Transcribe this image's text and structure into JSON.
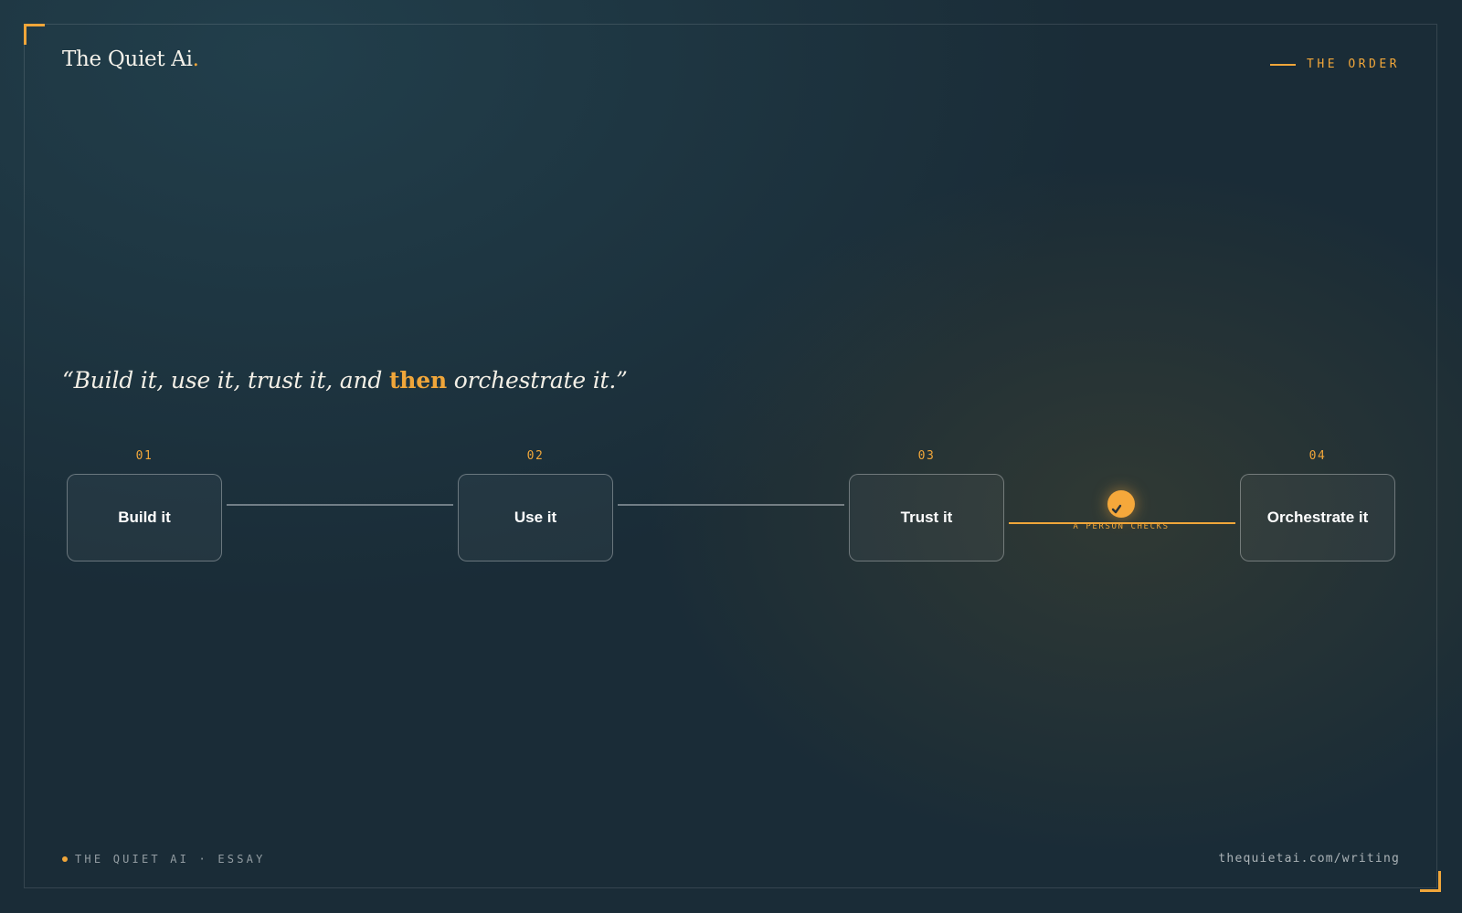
{
  "brand": {
    "name": "The Quiet Ai",
    "dot": "."
  },
  "header": {
    "tag": "THE ORDER"
  },
  "quote": {
    "open": "“Build it, use it, trust it, and ",
    "accent": "then",
    "close": " orchestrate it.”"
  },
  "steps": [
    {
      "number": "01",
      "label": "Build it"
    },
    {
      "number": "02",
      "label": "Use it"
    },
    {
      "number": "03",
      "label": "Trust it"
    },
    {
      "number": "04",
      "label": "Orchestrate it"
    }
  ],
  "checkpoint": {
    "label": "A PERSON CHECKS",
    "icon": "check-icon"
  },
  "footer": {
    "left": "THE QUIET AI · ESSAY",
    "right": "thequietai.com/writing"
  },
  "colors": {
    "accent": "#f0a63a",
    "background": "#1a2c37",
    "text": "#f2efe8"
  }
}
